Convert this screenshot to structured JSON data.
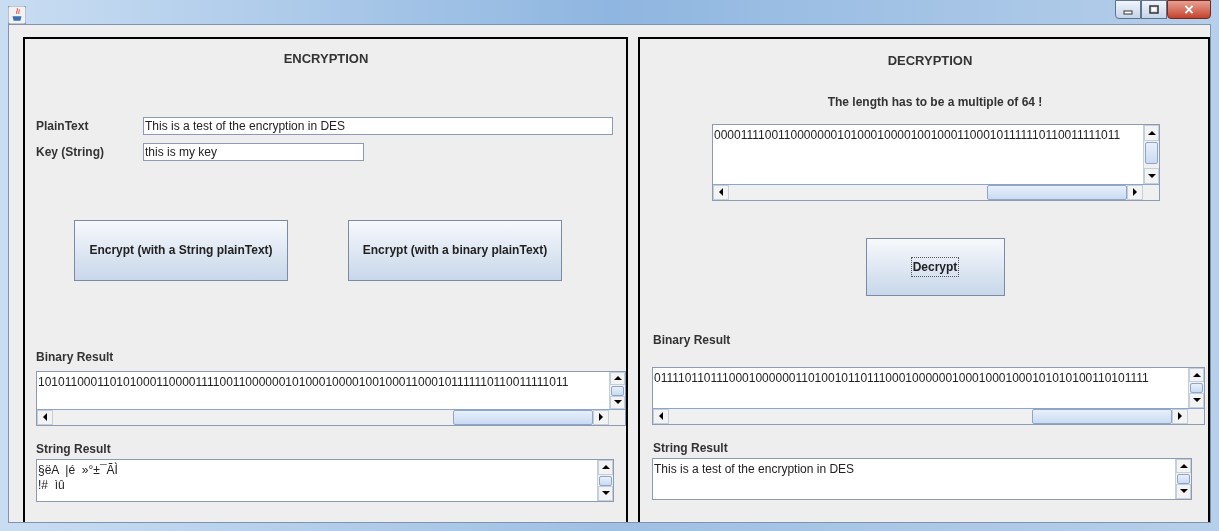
{
  "encryption": {
    "title": "ENCRYPTION",
    "fields": [
      {
        "label": "PlainText",
        "value": "This is a test of the encryption in DES"
      },
      {
        "label": "Key (String)",
        "value": "this is my key"
      }
    ],
    "buttons": [
      "Encrypt (with a String plainText)",
      "Encrypt (with a binary plainText)"
    ],
    "binary_result": {
      "label": "Binary Result",
      "lines": [
        "1010110001101010001100001111001100000010100010000100100011000101111110110011111011"
      ]
    },
    "string_result": {
      "label": "String Result",
      "lines": [
        "§ëA  |é  »°±¯ÃÌ",
        "!#  ìû"
      ]
    }
  },
  "decryption": {
    "title": "DECRYPTION",
    "note": "The length has to be a multiple of 64 !",
    "input": {
      "lines": [
        "000011110011000000010100010000100100011000101111110110011111011"
      ]
    },
    "button": {
      "label": "Decrypt",
      "focused": true
    },
    "binary_result": {
      "label": "Binary Result",
      "lines": [
        "0111101101110001000000110100101101110001000000100010001000101010100110101111"
      ]
    },
    "string_result": {
      "label": "String Result",
      "lines": [
        "This is a test of the encryption in DES"
      ]
    }
  }
}
